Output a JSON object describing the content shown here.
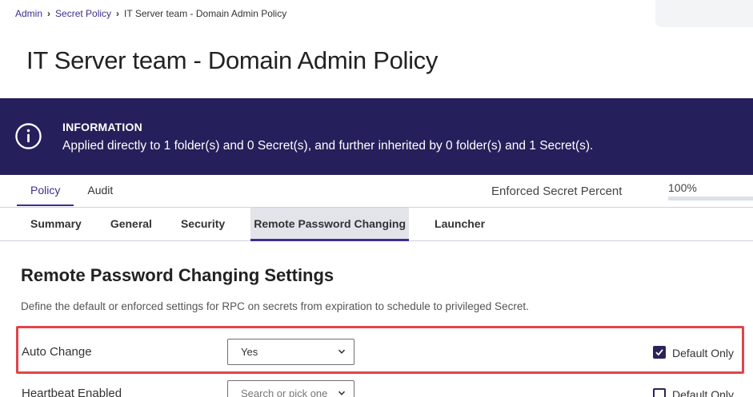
{
  "breadcrumb": {
    "items": [
      "Admin",
      "Secret Policy"
    ],
    "current": "IT Server team - Domain Admin Policy"
  },
  "page": {
    "title": "IT Server team - Domain Admin Policy"
  },
  "info_banner": {
    "icon": "info-circle-icon",
    "heading": "INFORMATION",
    "text": "Applied directly to 1 folder(s) and 0 Secret(s), and further inherited by 0 folder(s) and 1 Secret(s)."
  },
  "main_tabs": [
    {
      "label": "Policy",
      "active": true
    },
    {
      "label": "Audit",
      "active": false
    }
  ],
  "enforced": {
    "label": "Enforced Secret Percent",
    "value": "100%",
    "fraction": 1.0
  },
  "sub_tabs": [
    {
      "label": "Summary",
      "active": false
    },
    {
      "label": "General",
      "active": false
    },
    {
      "label": "Security",
      "active": false
    },
    {
      "label": "Remote Password Changing",
      "active": true
    },
    {
      "label": "Launcher",
      "active": false
    }
  ],
  "section": {
    "title": "Remote Password Changing Settings",
    "description": "Define the default or enforced settings for RPC on secrets from expiration to schedule to privileged Secret."
  },
  "settings": [
    {
      "label": "Auto Change",
      "select_value": "Yes",
      "checkbox_label": "Default Only",
      "checked": true
    },
    {
      "label": "Heartbeat Enabled",
      "select_placeholder": "Search or pick one",
      "checkbox_label": "Default Only",
      "checked": false
    }
  ],
  "colors": {
    "accent": "#3b2f8f",
    "banner": "#251f5b",
    "highlight": "#e0454a"
  }
}
